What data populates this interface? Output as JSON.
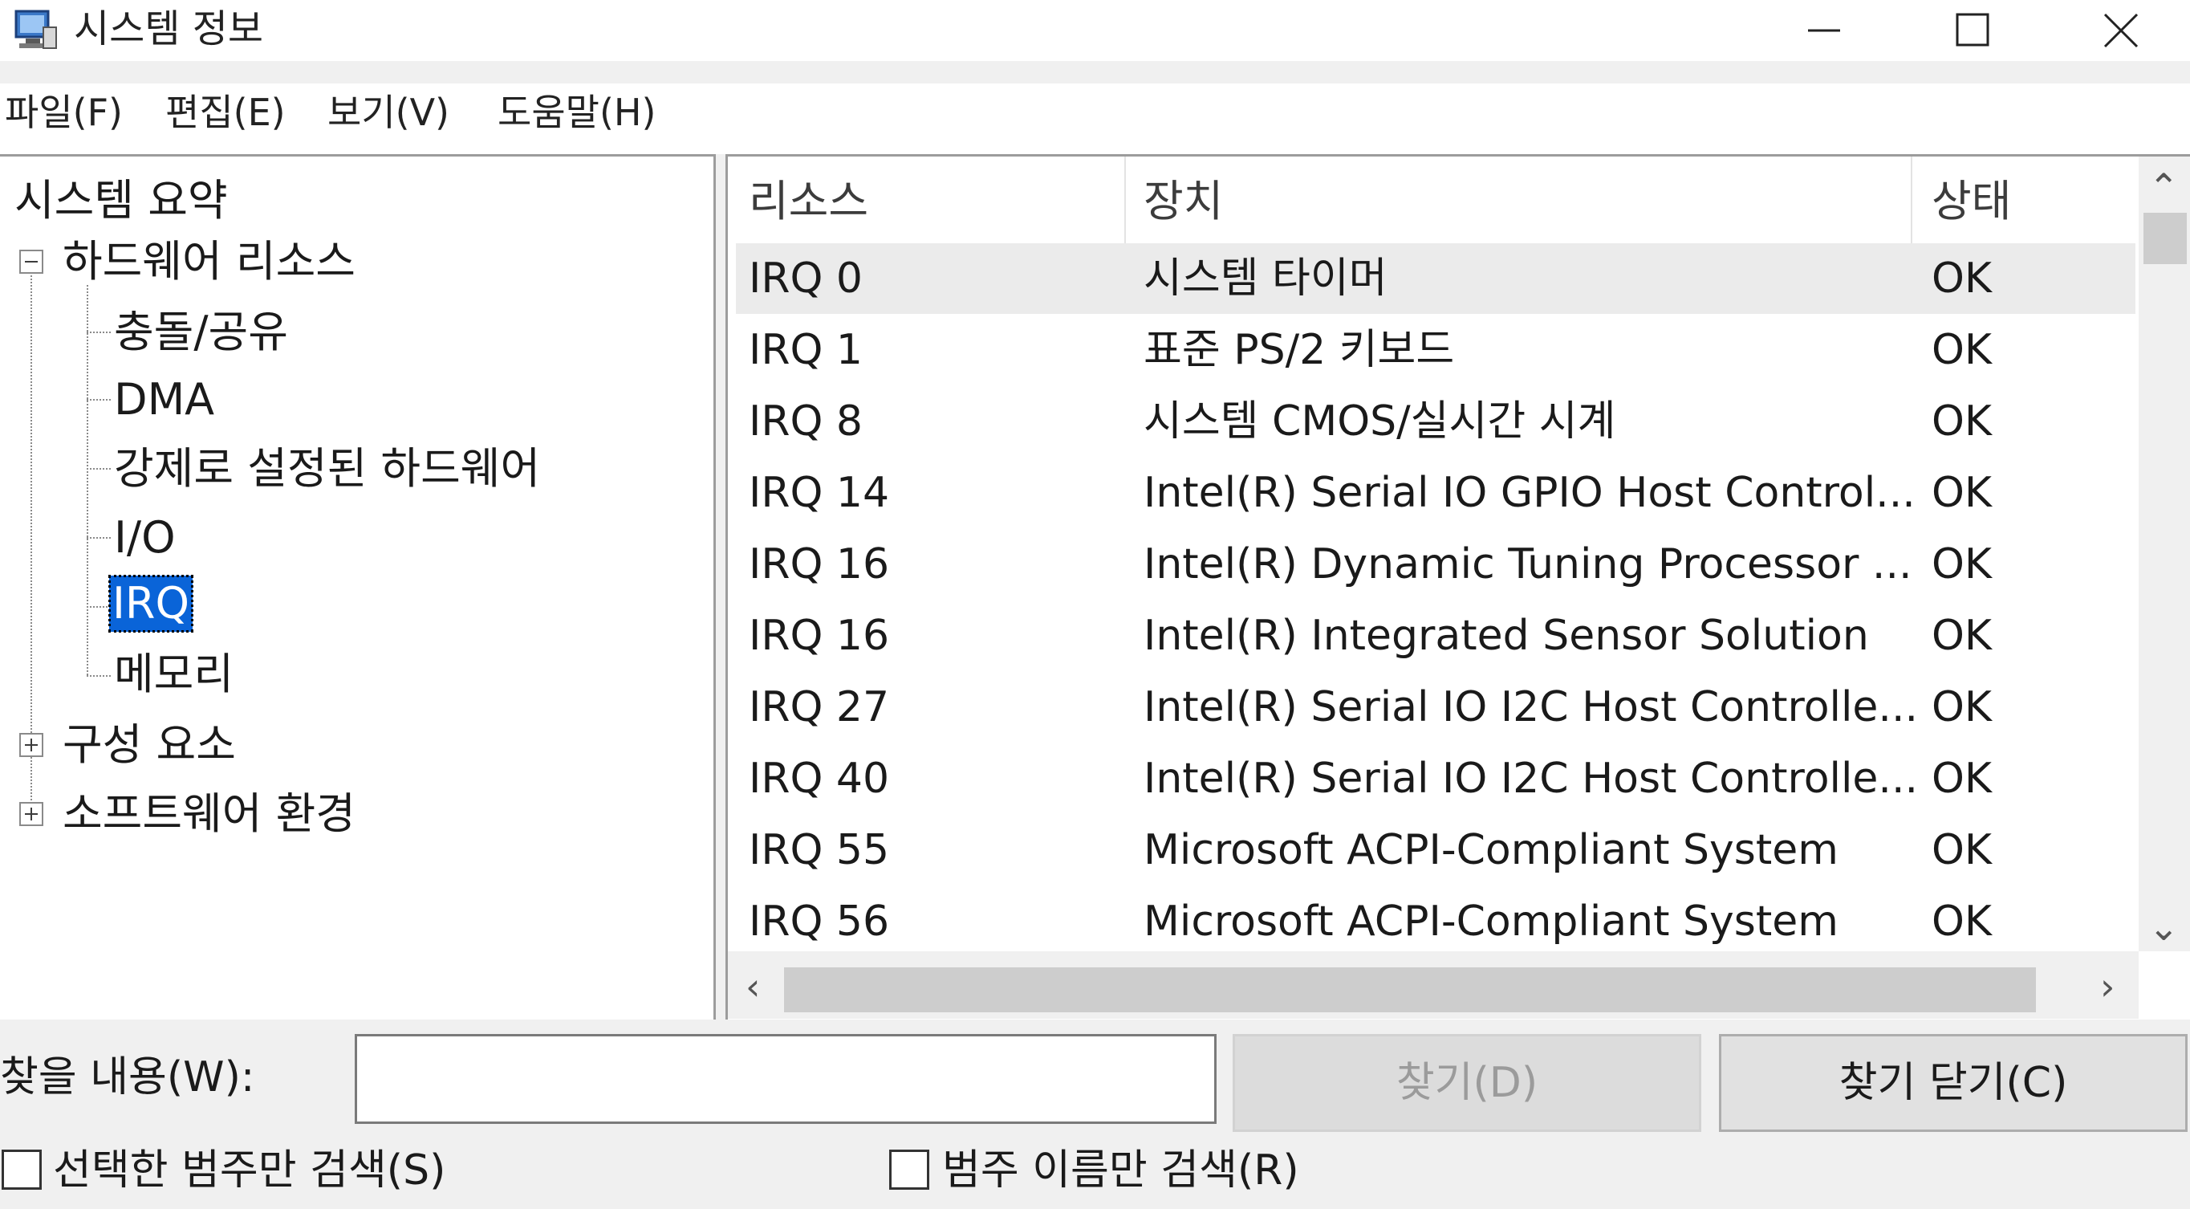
{
  "window": {
    "title": "시스템 정보"
  },
  "menu": [
    {
      "label": "파일(F)"
    },
    {
      "label": "편집(E)"
    },
    {
      "label": "보기(V)"
    },
    {
      "label": "도움말(H)"
    }
  ],
  "tree": {
    "root": "시스템 요약",
    "hardware": "하드웨어 리소스",
    "hardware_children": [
      "충돌/공유",
      "DMA",
      "강제로 설정된 하드웨어",
      "I/O",
      "IRQ",
      "메모리"
    ],
    "components": "구성 요소",
    "software": "소프트웨어 환경",
    "selected": "IRQ"
  },
  "table": {
    "columns": [
      "리소스",
      "장치",
      "상태"
    ],
    "rows": [
      {
        "resource": "IRQ 0",
        "device": "시스템 타이머",
        "status": "OK"
      },
      {
        "resource": "IRQ 1",
        "device": "표준 PS/2 키보드",
        "status": "OK"
      },
      {
        "resource": "IRQ 8",
        "device": "시스템 CMOS/실시간 시계",
        "status": "OK"
      },
      {
        "resource": "IRQ 14",
        "device": "Intel(R) Serial IO GPIO Host Control...",
        "status": "OK"
      },
      {
        "resource": "IRQ 16",
        "device": "Intel(R) Dynamic Tuning Processor ...",
        "status": "OK"
      },
      {
        "resource": "IRQ 16",
        "device": "Intel(R) Integrated Sensor Solution",
        "status": "OK"
      },
      {
        "resource": "IRQ 27",
        "device": "Intel(R) Serial IO I2C Host Controlle...",
        "status": "OK"
      },
      {
        "resource": "IRQ 40",
        "device": "Intel(R) Serial IO I2C Host Controlle...",
        "status": "OK"
      },
      {
        "resource": "IRQ 55",
        "device": "Microsoft ACPI-Compliant System",
        "status": "OK"
      },
      {
        "resource": "IRQ 56",
        "device": "Microsoft ACPI-Compliant System",
        "status": "OK"
      }
    ]
  },
  "find": {
    "label": "찾을 내용(W):",
    "value": "",
    "find_button": "찾기(D)",
    "close_button": "찾기 닫기(C)",
    "checkbox_selected_only": "선택한 범주만 검색(S)",
    "checkbox_category_names": "범주 이름만 검색(R)"
  },
  "colors": {
    "selection": "#0a64d8",
    "row_highlight": "#ebebeb",
    "background": "#f0f0f0"
  },
  "icons": [
    "system-info-app-icon",
    "minimize-icon",
    "maximize-icon",
    "close-icon",
    "tree-collapse-icon",
    "tree-expand-icon",
    "scroll-up-icon",
    "scroll-down-icon",
    "scroll-left-icon",
    "scroll-right-icon"
  ]
}
